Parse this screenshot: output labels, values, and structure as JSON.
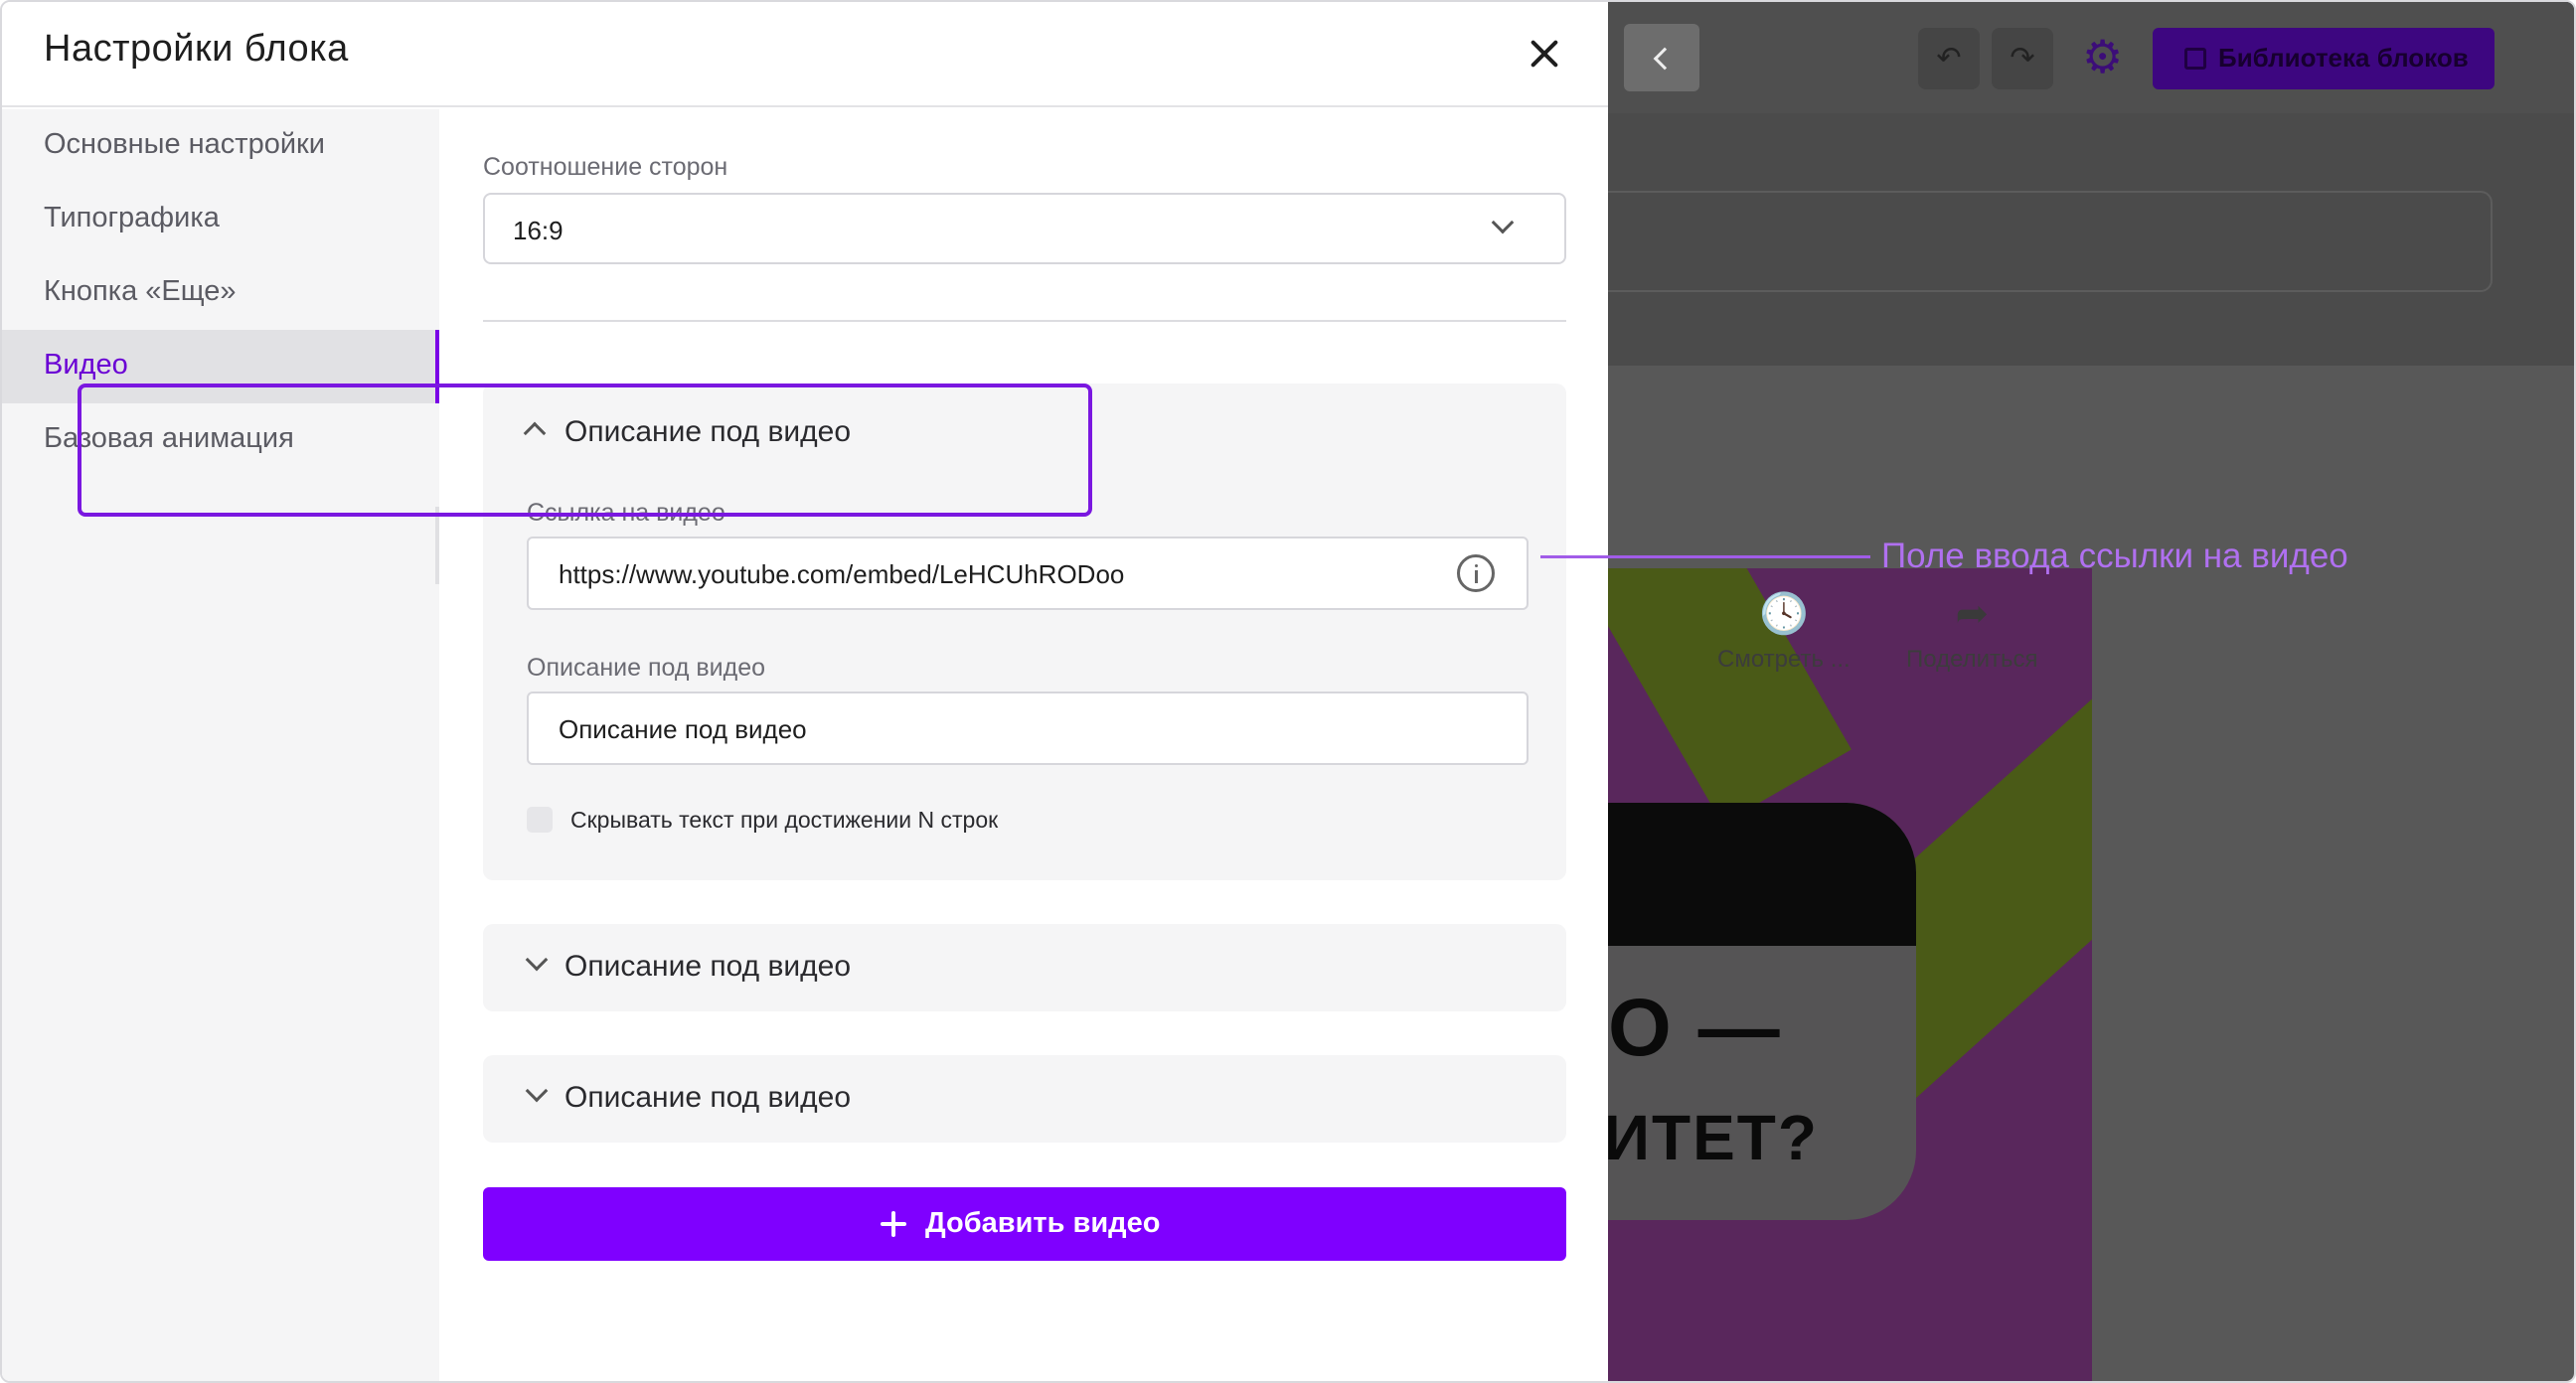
{
  "panel": {
    "title": "Настройки блока",
    "close_icon": "close-icon"
  },
  "sidebar": {
    "items": [
      {
        "label": "Основные настройки",
        "active": false
      },
      {
        "label": "Типографика",
        "active": false
      },
      {
        "label": "Кнопка «Еще»",
        "active": false
      },
      {
        "label": "Видео",
        "active": true
      },
      {
        "label": "Базовая анимация",
        "active": false
      }
    ]
  },
  "content": {
    "aspect_ratio": {
      "label": "Соотношение сторон",
      "value": "16:9"
    },
    "accordions": [
      {
        "title": "Описание под видео",
        "expanded": true,
        "video_link": {
          "label": "Ссылка на видео",
          "value": "https://www.youtube.com/embed/LeHCUhRODoo"
        },
        "description": {
          "label": "Описание под видео",
          "value": "Описание под видео"
        },
        "hide_text_checkbox": {
          "label": "Скрывать текст при достижении N строк",
          "checked": false
        }
      },
      {
        "title": "Описание под видео",
        "expanded": false
      },
      {
        "title": "Описание под видео",
        "expanded": false
      }
    ],
    "add_button": {
      "label": "Добавить видео"
    }
  },
  "preview": {
    "library_button": "Библиотека блоков",
    "video_actions": [
      {
        "label": "Смотреть ...",
        "icon": "clock-icon"
      },
      {
        "label": "Поделиться",
        "icon": "share-icon"
      }
    ],
    "video_text_line1": "О —",
    "video_text_line2": "ИТЕТ?"
  },
  "annotation": {
    "text": "Поле ввода ссылки на видео",
    "color": "#b070f0"
  },
  "colors": {
    "accent": "#7f00ff",
    "active_nav_text": "#6a00d4",
    "highlight_border": "#7a17e0"
  }
}
